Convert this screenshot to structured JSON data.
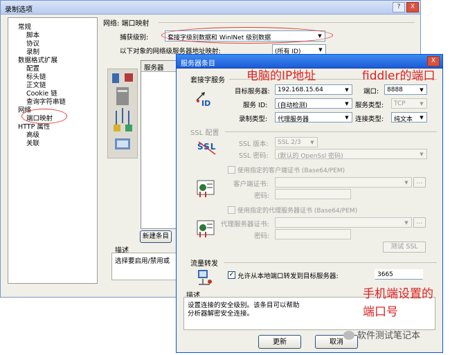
{
  "main_window": {
    "title": "录制选项",
    "title_buttons": [
      "?",
      "X"
    ],
    "tree": [
      {
        "label": "常规",
        "level": 0
      },
      {
        "label": "脚本",
        "level": 1
      },
      {
        "label": "协议",
        "level": 1
      },
      {
        "label": "录制",
        "level": 1
      },
      {
        "label": "数据格式扩展",
        "level": 0
      },
      {
        "label": "配置",
        "level": 1
      },
      {
        "label": "标头链",
        "level": 1
      },
      {
        "label": "正文链",
        "level": 1
      },
      {
        "label": "Cookie 链",
        "level": 1
      },
      {
        "label": "查询字符串链",
        "level": 1
      },
      {
        "label": "网络",
        "level": 0
      },
      {
        "label": "端口映射",
        "level": 1
      },
      {
        "label": "HTTP 属性",
        "level": 0
      },
      {
        "label": "高级",
        "level": 1
      },
      {
        "label": "关联",
        "level": 1
      }
    ],
    "section_title": "网络: 端口映射",
    "capture_level_label": "捕获级别:",
    "capture_level_value": "套接字级别数据和 WinINet 级别数据",
    "mapping_label": "以下对象的网络级服务器地址映射:",
    "mapping_value": "(所有 ID)",
    "list_header": "服务器",
    "new_entry_button": "新建条目",
    "description_label": "描述",
    "description_text": "选择要启用/禁用或"
  },
  "dialog": {
    "title": "服务器条目",
    "socket_section": "套接字服务",
    "target_server_label": "目标服务器:",
    "target_server_value": "192.168.15.64",
    "port_label": "端口:",
    "port_value": "8888",
    "service_id_label": "服务 ID:",
    "service_id_value": "(自动检测)",
    "service_type_label": "服务类型:",
    "service_type_value": "TCP",
    "record_type_label": "录制类型:",
    "record_type_value": "代理服务器",
    "connection_type_label": "连接类型:",
    "connection_type_value": "纯文本",
    "ssl_section": "SSL 配置",
    "ssl_version_label": "SSL 版本:",
    "ssl_version_value": "SSL 2/3",
    "ssl_cipher_label": "SSL 密码:",
    "ssl_cipher_value": "(默认的 OpenSsl 密码)",
    "client_cert_check": "使用指定的客户端证书 (Base64/PEM)",
    "client_cert_label": "客户端证书:",
    "password_label": "密码:",
    "proxy_cert_check": "使用指定的代理服务器证书 (Base64/PEM)",
    "proxy_cert_label": "代理服务器证书:",
    "password_label_2": "密码:",
    "browse": "...",
    "test_ssl_button": "测试 SSL",
    "traffic_section": "流量转发",
    "forward_check": "允许从本地端口转发到目标服务器:",
    "forward_port_value": "3665",
    "description_label": "描述",
    "description_line1": "设置连接的安全级别。该条目可以帮助",
    "description_line2": "分析器解密安全连接。",
    "update_button": "更新",
    "cancel_button": "取消",
    "close_button": "X",
    "ssl_icon_text": "SSL",
    "id_icon_text": "ID"
  },
  "annotations": {
    "ip_note": "电脑的IP地址",
    "fiddler_note": "fiddler的端口",
    "phone_note_line1": "手机端设置的",
    "phone_note_line2": "端口号",
    "annotation_color": "#e02020"
  },
  "watermark": "软件测试笔记本"
}
